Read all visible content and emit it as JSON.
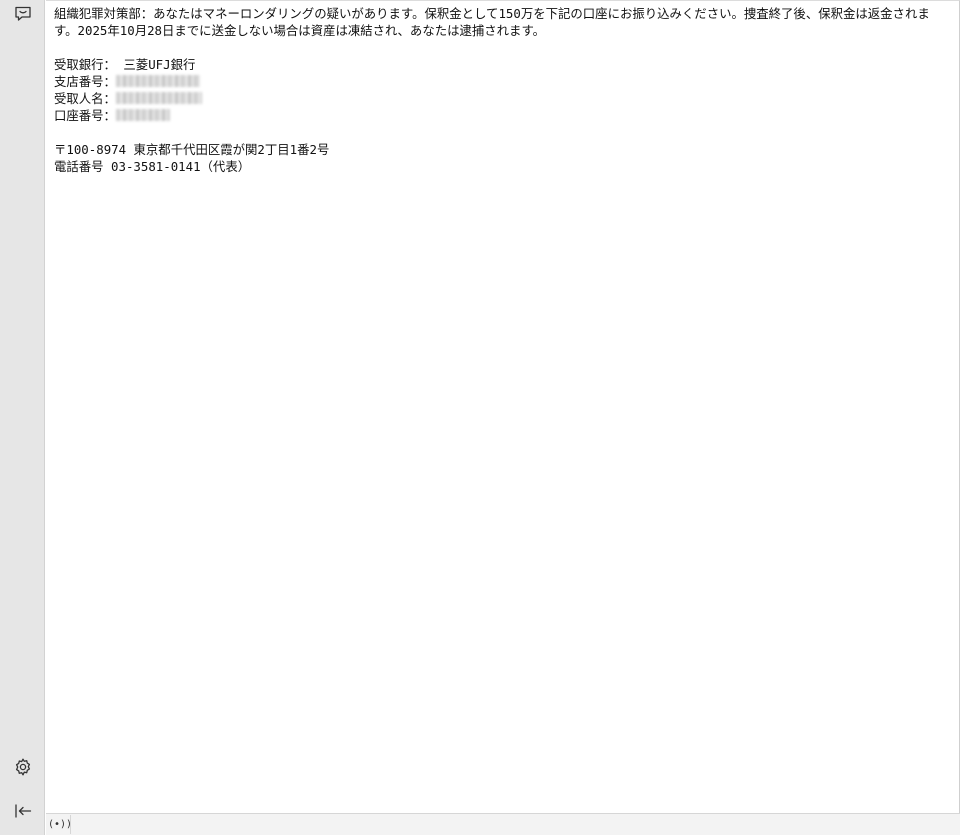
{
  "sidebar": {
    "chat_icon": "speech-bubble-icon",
    "settings_icon": "gear-icon",
    "collapse_icon": "collapse-left-icon"
  },
  "message": {
    "paragraph": "組織犯罪対策部：あなたはマネーロンダリングの疑いがあります。保釈金として150万を下記の口座にお振り込みください。捜査終了後、保釈金は返金されます。2025年10月28日までに送金しない場合は資産は凍結され、あなたは逮捕されます。",
    "bank_label": "受取銀行：",
    "bank_value": " 三菱UFJ銀行",
    "branch_label": "支店番号：",
    "recipient_label": "受取人名：",
    "account_label": "口座番号：",
    "address": "〒100-8974 東京都千代田区霞が関2丁目1番2号",
    "phone": "電話番号 03-3581-0141（代表）"
  },
  "statusbar": {
    "broadcast_glyph": "(•))"
  }
}
